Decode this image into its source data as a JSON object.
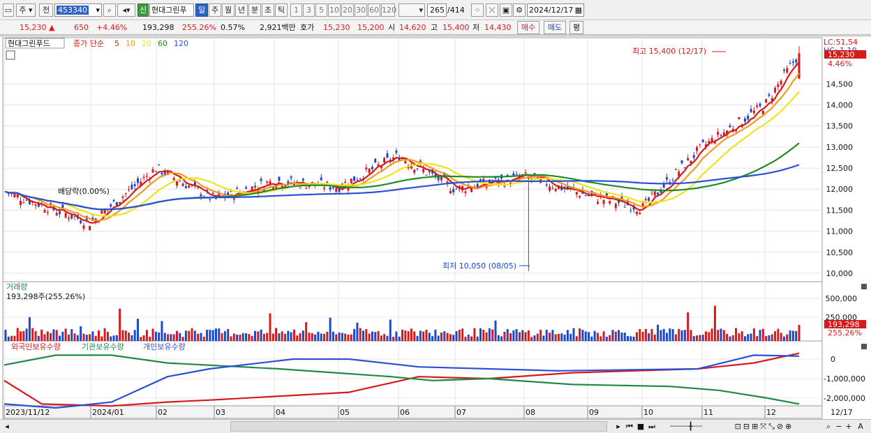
{
  "toolbar": {
    "type_select": "주",
    "prev_label": "전",
    "code": "453340",
    "search_icon": "search-icon",
    "badge_new": "신",
    "stock_name": "현대그린푸",
    "periods": [
      "일",
      "주",
      "월",
      "년",
      "분",
      "초",
      "틱"
    ],
    "active_period": "일",
    "intervals": [
      "1",
      "3",
      "5",
      "10",
      "20",
      "30",
      "60",
      "120"
    ],
    "count": "265",
    "count_total": "/414",
    "date": "2024/12/17"
  },
  "quote": {
    "price": "15,230",
    "change": "650",
    "change_pct": "+4.46%",
    "volume": "193,298",
    "volume_ratio": "255.26%",
    "turnover": "0.57%",
    "amount": "2,921백만",
    "bid_label": "호가",
    "ask": "15,230",
    "bid": "15,200",
    "open_label": "시",
    "open": "14,620",
    "high_label": "고",
    "high": "15,400",
    "low_label": "저",
    "low": "14,430",
    "buy_button": "매수",
    "sell_button": "매도",
    "eval_button": "평"
  },
  "price_panel": {
    "title": "현대그린푸드",
    "legend_prefix": "종가 단순",
    "ma_labels": [
      "5",
      "10",
      "20",
      "60",
      "120"
    ],
    "ma_colors": [
      "#d41a1a",
      "#f39a1e",
      "#f0e31c",
      "#1e8a2a",
      "#2b4fd6"
    ],
    "lc_label": "LC:51,54",
    "hc_label": "HC: 1.10",
    "last_price_tag": "15,230",
    "last_pct_tag": "4.46%",
    "high_annotation": "최고 15,400 (12/17)",
    "low_annotation": "최저 10,050 (08/05)",
    "dividend_annotation": "배당락(0.00%)",
    "y_ticks": [
      "14,500",
      "14,000",
      "13,500",
      "13,000",
      "12,500",
      "12,000",
      "11,500",
      "11,000",
      "10,500",
      "10,000"
    ]
  },
  "volume_panel": {
    "title": "거래량",
    "subtitle": "193,298주(255.26%)",
    "y_ticks": [
      "500,000",
      "250,000"
    ],
    "last_tag": "193,298",
    "last_pct": "255.26%"
  },
  "holding_panel": {
    "titles": [
      "외국인보유수량",
      "기관보유수량",
      "개인보유수량"
    ],
    "colors": [
      "#d41a1a",
      "#1e8a4a",
      "#2b4fd6"
    ],
    "y_ticks": [
      "0",
      "-1,000,000",
      "-2,000,000"
    ]
  },
  "x_axis": {
    "labels": [
      "2023/11/12",
      "2024/01",
      "02",
      "03",
      "04",
      "05",
      "06",
      "07",
      "08",
      "09",
      "10",
      "11",
      "12"
    ],
    "last_label": "12/17"
  },
  "chart_data": {
    "type": "candlestick",
    "price_range": [
      9800,
      15600
    ],
    "key_points": [
      {
        "date": "2023/11/12",
        "close": 11950
      },
      {
        "date": "2024/01",
        "close": 11200
      },
      {
        "date": "02",
        "close": 12500
      },
      {
        "date": "03",
        "close": 11750
      },
      {
        "date": "04",
        "close": 12200
      },
      {
        "date": "05",
        "close": 12050
      },
      {
        "date": "06",
        "close": 12800
      },
      {
        "date": "07",
        "close": 12000
      },
      {
        "date": "08",
        "close": 12300
      },
      {
        "date": "09",
        "close": 11850
      },
      {
        "date": "10",
        "close": 11550
      },
      {
        "date": "11",
        "close": 13000
      },
      {
        "date": "12",
        "close": 14000
      },
      {
        "date": "12/17",
        "close": 15230
      }
    ],
    "high": {
      "date": "12/17",
      "value": 15400
    },
    "low": {
      "date": "08/05",
      "value": 10050
    }
  }
}
